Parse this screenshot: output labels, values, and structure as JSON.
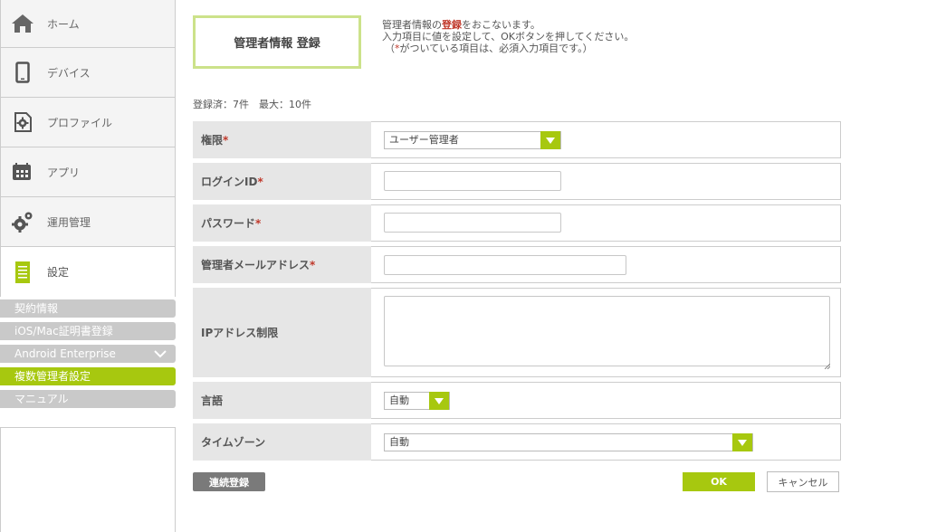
{
  "sidebar": {
    "items": [
      {
        "label": "ホーム",
        "icon": "home-icon"
      },
      {
        "label": "デバイス",
        "icon": "smartphone-icon"
      },
      {
        "label": "プロファイル",
        "icon": "profile-gear-icon"
      },
      {
        "label": "アプリ",
        "icon": "app-calendar-icon"
      },
      {
        "label": "運用管理",
        "icon": "gears-icon"
      },
      {
        "label": "設定",
        "icon": "settings-document-icon"
      }
    ],
    "submenu": [
      {
        "label": "契約情報"
      },
      {
        "label": "iOS/Mac証明書登録"
      },
      {
        "label": "Android Enterprise"
      },
      {
        "label": "複数管理者設定"
      },
      {
        "label": "マニュアル"
      }
    ]
  },
  "page": {
    "title": "管理者情報 登録",
    "intro": {
      "line1_pre": "管理者情報の",
      "line1_hl": "登録",
      "line1_post": "をおこないます。",
      "line2": "入力項目に値を設定して、OKボタンを押してください。",
      "line3_pre": "（",
      "line3_ast": "*",
      "line3_post": "がついている項目は、必須入力項目です。）"
    },
    "count_text": "登録済：7件　最大：10件"
  },
  "form": {
    "required_mark": "*",
    "authority": {
      "label": "権限",
      "value": "ユーザー管理者"
    },
    "login_id": {
      "label": "ログインID",
      "value": ""
    },
    "password": {
      "label": "パスワード",
      "value": ""
    },
    "email": {
      "label": "管理者メールアドレス",
      "value": ""
    },
    "ip_restriction": {
      "label": "IPアドレス制限",
      "value": ""
    },
    "language": {
      "label": "言語",
      "value": "自動"
    },
    "timezone": {
      "label": "タイムゾーン",
      "value": "自動"
    }
  },
  "buttons": {
    "continuous": "連続登録",
    "ok": "OK",
    "cancel": "キャンセル"
  },
  "colors": {
    "accent": "#a7c80f",
    "title_border": "#cce28a",
    "required": "#c0392b",
    "label_bg": "#e6e6e6",
    "submenu_bg": "#c9c9c9"
  }
}
